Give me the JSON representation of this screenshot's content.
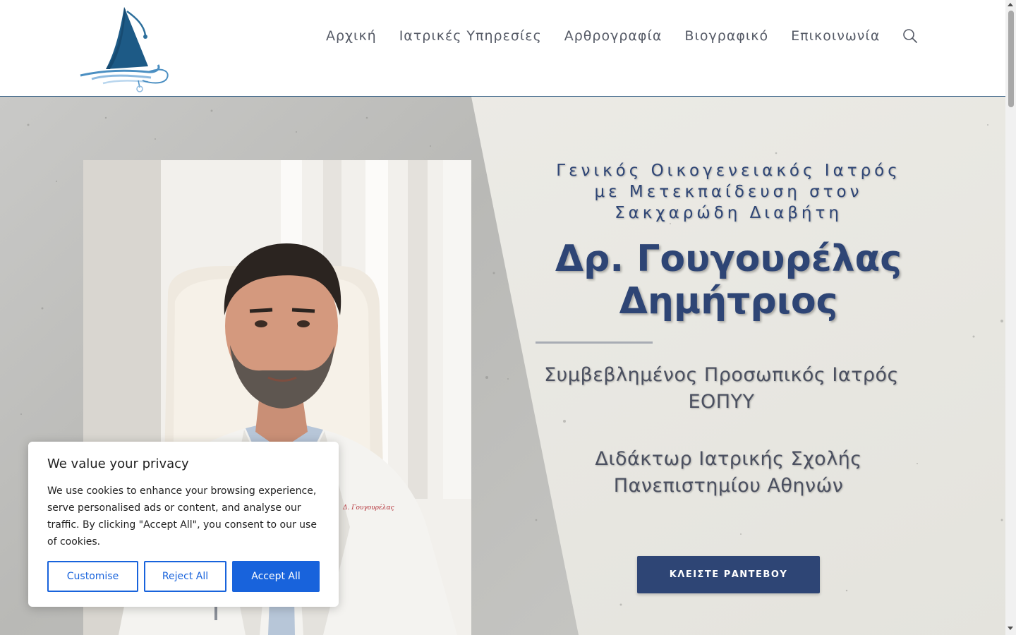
{
  "site": {
    "logo_icon": "sailboat-stethoscope-logo"
  },
  "nav": {
    "items": [
      {
        "label": "Αρχική"
      },
      {
        "label": "Ιατρικές Υπηρεσίες"
      },
      {
        "label": "Αρθρογραφία"
      },
      {
        "label": "Βιογραφικό"
      },
      {
        "label": "Επικοινωνία"
      }
    ],
    "search_icon": "search-icon"
  },
  "hero": {
    "subtitle_lines": [
      "Γενικός Οικογενειακός Ιατρός",
      "με Μετεκπαίδευση στον",
      "Σακχαρώδη Διαβήτη"
    ],
    "title_lines": [
      "Δρ. Γουγουρέλας",
      "Δημήτριος"
    ],
    "credential1_lines": [
      "Συμβεβλημένος Προσωπικός Ιατρός",
      "ΕΟΠΥΥ"
    ],
    "credential2_lines": [
      "Διδάκτωρ Ιατρικής Σχολής",
      "Πανεπιστημίου Αθηνών"
    ],
    "cta_label": "ΚΛΕΙΣΤΕ ΡΑΝΤΕΒΟΥ",
    "portrait_coat_label": "Δ. Γουγουρέλας"
  },
  "cookie": {
    "title": "We value your privacy",
    "text": "We use cookies to enhance your browsing experience, serve personalised ads or content, and analyse our traffic. By clicking \"Accept All\", you consent to our use of cookies.",
    "customise_label": "Customise",
    "reject_label": "Reject All",
    "accept_label": "Accept All"
  },
  "colors": {
    "brand_navy": "#2e4575",
    "accept_blue": "#1863dc",
    "nav_text": "#555a66"
  }
}
